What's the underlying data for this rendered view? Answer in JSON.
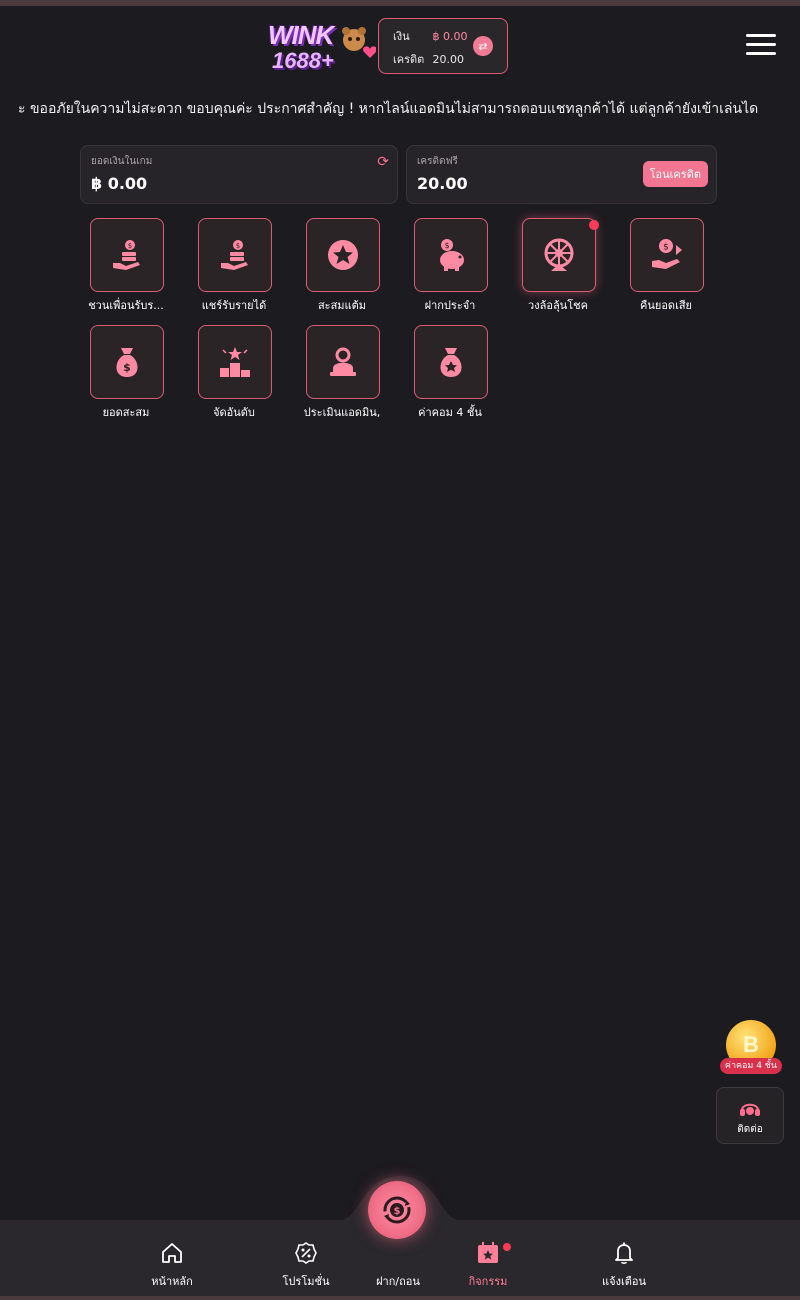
{
  "header": {
    "logo_text_top": "WINK",
    "logo_text_bottom": "1688+",
    "wallet": {
      "cash_label": "เงิน",
      "cash_value": "฿ 0.00",
      "credit_label": "เครดิต",
      "credit_value": "20.00"
    }
  },
  "announcement": "ะ ขออภัยในความไม่สะดวก ขอบคุณค่ะ    ประกาศสำคัญ ! หากไลน์แอดมินไม่สามารถตอบแชทลูกค้าได้ แต่ลูกค้ายังเข้าเล่นได",
  "balance": {
    "game_label": "ยอดเงินในเกม",
    "game_value": "฿ 0.00",
    "free_label": "เครดิตฟรี",
    "free_value": "20.00",
    "transfer_label": "โอนเครดิต"
  },
  "menu_items": [
    {
      "label": "ชวนเพื่อนรับร...",
      "icon": "coins-hand-icon"
    },
    {
      "label": "แชร์รับรายได้",
      "icon": "coins-hand-icon"
    },
    {
      "label": "สะสมแต้ม",
      "icon": "star-badge-icon"
    },
    {
      "label": "ฝากประจำ",
      "icon": "piggy-bank-icon"
    },
    {
      "label": "วงล้อลุ้นโชค",
      "icon": "wheel-icon"
    },
    {
      "label": "คืนยอดเสีย",
      "icon": "cashback-icon"
    },
    {
      "label": "ยอดสะสม",
      "icon": "money-bag-icon"
    },
    {
      "label": "จัดอันดับ",
      "icon": "podium-icon"
    },
    {
      "label": "ประเมินแอดมิน,",
      "icon": "admin-icon"
    },
    {
      "label": "ค่าคอม 4 ชั้น",
      "icon": "star-bag-icon"
    }
  ],
  "floating": {
    "commission_tag": "ค่าคอม 4 ชั้น",
    "coin_symbol": "B",
    "contact_label": "ติดต่อ"
  },
  "bottom_nav": [
    {
      "label": "หน้าหลัก",
      "icon": "home-icon"
    },
    {
      "label": "โปรโมชั่น",
      "icon": "percent-icon"
    },
    {
      "label": "ฝาก/ถอน",
      "icon": "deposit-icon"
    },
    {
      "label": "กิจกรรม",
      "icon": "calendar-star-icon"
    },
    {
      "label": "แจ้งเตือน",
      "icon": "bell-icon"
    }
  ],
  "colors": {
    "background": "#1c1b1f",
    "accent": "#f27591",
    "border": "#d85c73",
    "badge": "#ff3b57"
  }
}
